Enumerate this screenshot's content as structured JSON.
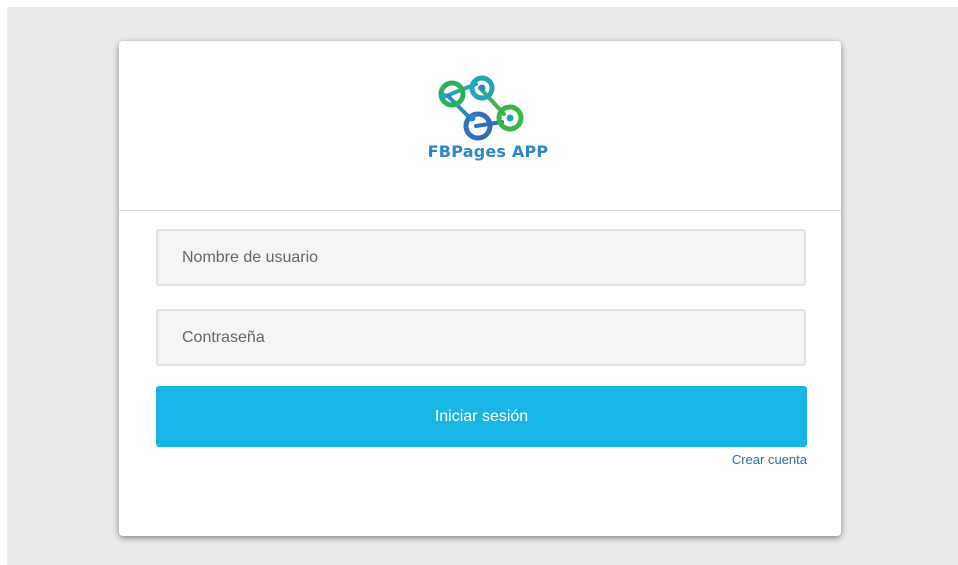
{
  "app": {
    "logo_text": "FBPages APP"
  },
  "form": {
    "username_placeholder": "Nombre de usuario",
    "password_placeholder": "Contraseña",
    "submit_label": "Iniciar sesión",
    "create_account_label": "Crear cuenta"
  },
  "colors": {
    "background": "#ebebeb",
    "primary_button": "#19b5e6",
    "link": "#2e6da4",
    "logo_green": "#3bb54a",
    "logo_teal": "#23a7b8",
    "logo_blue": "#2e87c9"
  },
  "icons": {
    "logo": "linked-circles-logo"
  }
}
